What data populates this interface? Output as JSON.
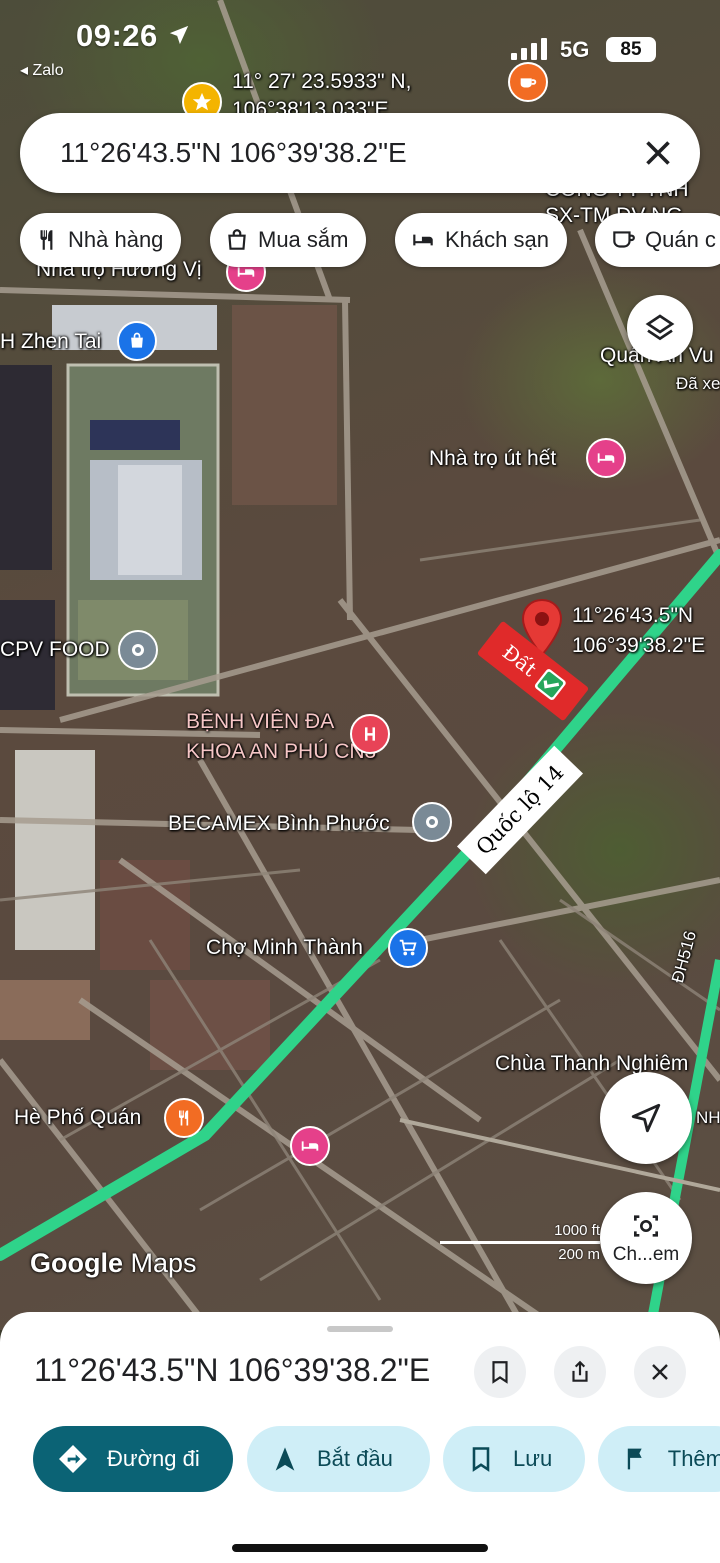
{
  "status_bar": {
    "time": "09:26",
    "back_app": "◂ Zalo",
    "network": "5G",
    "battery": "85"
  },
  "search": {
    "query": "11°26'43.5\"N 106°39'38.2\"E"
  },
  "chips": [
    {
      "label": "Nhà hàng",
      "icon": "fork-knife-icon"
    },
    {
      "label": "Mua sắm",
      "icon": "shopping-bag-icon"
    },
    {
      "label": "Khách sạn",
      "icon": "bed-icon"
    },
    {
      "label": "Quán c",
      "icon": "coffee-cup-icon"
    }
  ],
  "map": {
    "top_coord_label": {
      "line1": "11° 27' 23.5933\" N,",
      "line2": "106°38'13.033\"E"
    },
    "pin_coord": {
      "line1": "11°26'43.5\"N",
      "line2": "106°39'38.2\"E"
    },
    "road_tag": "Quốc lộ 14",
    "land_tag": "Đất",
    "places": [
      {
        "name": "Nhà trọ Hương Vị",
        "icon": "bed-icon",
        "color": "#e5408a"
      },
      {
        "name": "H Zhen Tai",
        "icon": "shopping-bag-icon",
        "color": "#1a73e8"
      },
      {
        "name": "Quán Ăn Vu",
        "icon": "",
        "color": ""
      },
      {
        "name": "Đã xe",
        "icon": "",
        "color": ""
      },
      {
        "name": "Nhà trọ út hết",
        "icon": "bed-icon",
        "color": "#e5408a"
      },
      {
        "name": "CPV FOOD",
        "icon": "pin-icon",
        "color": "#7a8a96"
      },
      {
        "name": "BỆNH VIỆN ĐA",
        "icon": "",
        "color": ""
      },
      {
        "name": "KHOA AN PHÚ CN3",
        "icon": "hospital-icon",
        "color": "#e84357"
      },
      {
        "name": "BECAMEX Bình Phước",
        "icon": "pin-icon",
        "color": "#7a8a96"
      },
      {
        "name": "Chợ Minh Thành",
        "icon": "cart-icon",
        "color": "#1a73e8"
      },
      {
        "name": "Chùa Thanh Nghiêm",
        "icon": "",
        "color": ""
      },
      {
        "name": "Hè Phố Quán",
        "icon": "fork-knife-icon",
        "color": "#f26c23"
      },
      {
        "name": "CÔNG TY TNH",
        "icon": "",
        "color": ""
      },
      {
        "name": "SX-TM DV NG",
        "icon": "",
        "color": ""
      },
      {
        "name": "ĐH516",
        "icon": "",
        "color": ""
      },
      {
        "name": "NH",
        "icon": "",
        "color": ""
      }
    ],
    "brand": {
      "google": "Google",
      "maps": "Maps"
    },
    "scale": {
      "ft": "1000 ft",
      "m": "200 m"
    }
  },
  "fabs": {
    "layers_icon": "layers-icon",
    "locate_icon": "navigation-arrow-icon",
    "lens_label": "Ch...em"
  },
  "sheet": {
    "title": "11°26'43.5\"N 106°39'38.2\"E",
    "actions": [
      {
        "label": "Đường đi",
        "icon": "directions-icon"
      },
      {
        "label": "Bắt đầu",
        "icon": "navigation-icon"
      },
      {
        "label": "Lưu",
        "icon": "bookmark-icon"
      },
      {
        "label": "Thêm",
        "icon": "flag-icon"
      }
    ]
  },
  "colors": {
    "route": "#2fd38a",
    "primary_button": "#0b6375",
    "secondary_button": "#cfeef7",
    "pin": "#e53935"
  }
}
